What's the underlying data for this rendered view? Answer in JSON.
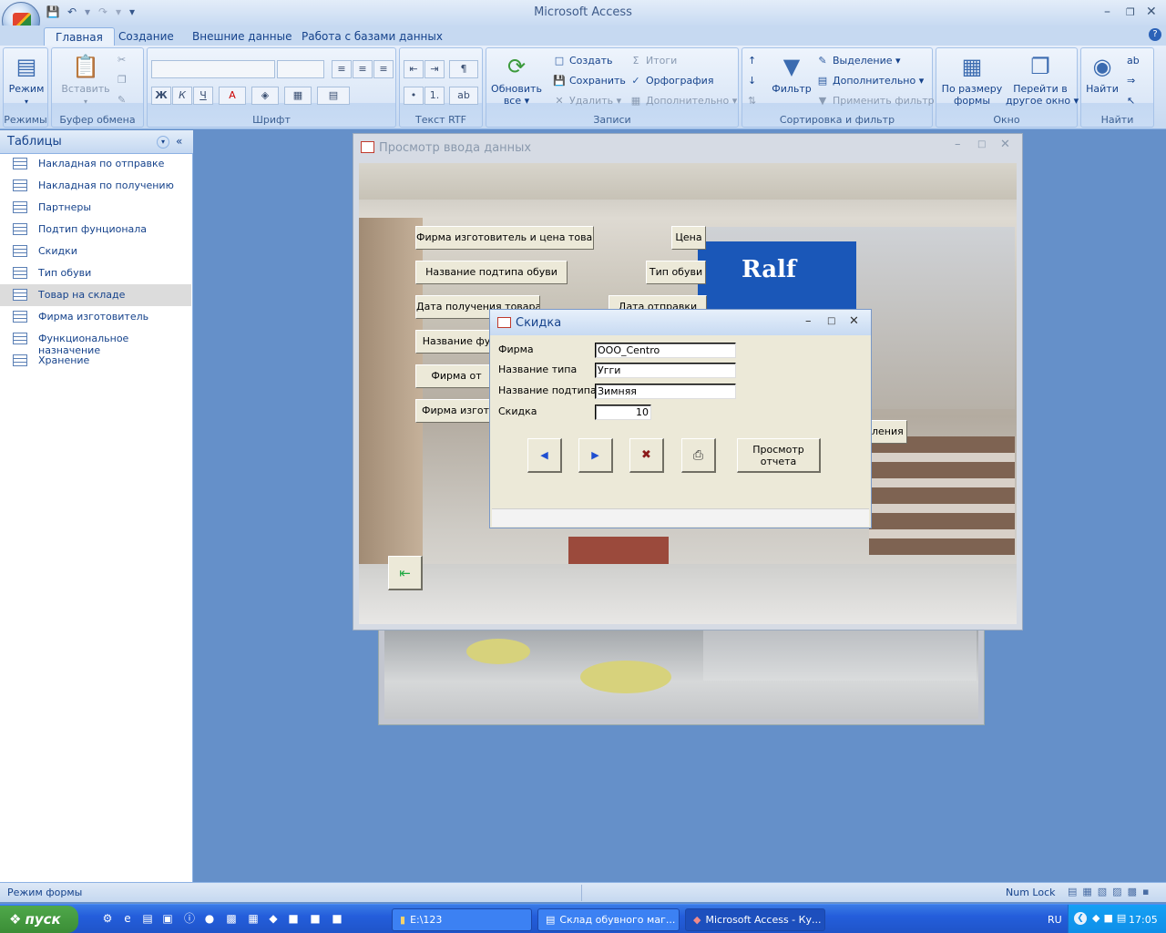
{
  "app": {
    "title": "Microsoft Access"
  },
  "tabs": [
    "Главная",
    "Создание",
    "Внешние данные",
    "Работа с базами данных"
  ],
  "ribbon": {
    "mode": {
      "label": "Режим",
      "group": "Режимы"
    },
    "clipboard": {
      "paste": "Вставить",
      "group": "Буфер обмена"
    },
    "font": {
      "bold": "Ж",
      "italic": "К",
      "underline": "Ч",
      "group": "Шрифт"
    },
    "rtf": {
      "group": "Текст RTF"
    },
    "records": {
      "refresh": "Обновить",
      "refresh2": "все",
      "create": "Создать",
      "save": "Сохранить",
      "delete": "Удалить",
      "totals": "Итоги",
      "spelling": "Орфография",
      "more": "Дополнительно",
      "group": "Записи"
    },
    "sort": {
      "filter": "Фильтр",
      "selection": "Выделение",
      "advanced": "Дополнительно",
      "apply": "Применить фильтр",
      "group": "Сортировка и фильтр"
    },
    "window": {
      "fit1": "По размеру",
      "fit2": "формы",
      "switch1": "Перейти в",
      "switch2": "другое окно",
      "group": "Окно"
    },
    "find": {
      "find": "Найти",
      "group": "Найти"
    }
  },
  "nav": {
    "header": "Таблицы",
    "items": [
      "Накладная по отправке",
      "Накладная по получению",
      "Партнеры",
      "Подтип фунционала",
      "Скидки",
      "Тип обуви",
      "Товар на складе",
      "Фирма изготовитель",
      "Функциональное назначение",
      "Хранение"
    ]
  },
  "form": {
    "title": "Просмотр ввода данных",
    "buttons": [
      "Фирма изготовитель и цена товара",
      "Цена",
      "Название подтипа обуви",
      "Тип обуви",
      "Дата получения товара",
      "Дата отправки",
      "Название фу",
      "Фирма от",
      "Фирма изготов",
      "ления"
    ],
    "sign": "Ralf"
  },
  "dialog": {
    "title": "Скидка",
    "fields": [
      {
        "label": "Фирма",
        "value": "OOO_Centro"
      },
      {
        "label": "Название типа",
        "value": "Угги"
      },
      {
        "label": "Название подтипа",
        "value": "Зимняя"
      },
      {
        "label": "Скидка",
        "value": "10"
      }
    ],
    "report_btn1": "Просмотр",
    "report_btn2": "отчета"
  },
  "status": {
    "left": "Режим формы",
    "numlock": "Num Lock"
  },
  "taskbar": {
    "start": "пуск",
    "tasks": [
      "E:\\123",
      "Склад обувного маг...",
      "Microsoft Access - Ку..."
    ],
    "lang": "RU",
    "clock": "17:05"
  }
}
